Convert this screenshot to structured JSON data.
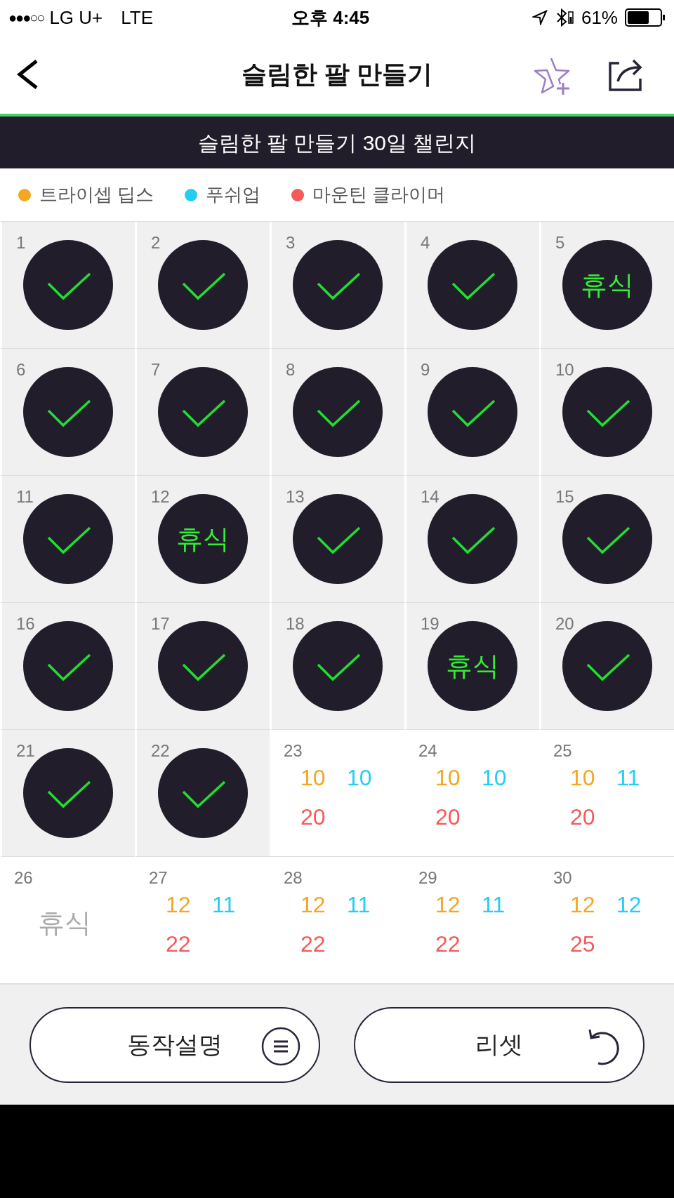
{
  "status_bar": {
    "signal": "●●●○○",
    "carrier": "LG U+",
    "network": "LTE",
    "time": "오후 4:45",
    "battery_percent": "61%"
  },
  "nav": {
    "title": "슬림한 팔 만들기"
  },
  "banner": "슬림한 팔 만들기 30일 챌린지",
  "legend": [
    {
      "label": "트라이셉 딥스",
      "color": "#f5a623"
    },
    {
      "label": "푸쉬업",
      "color": "#25cdf5"
    },
    {
      "label": "마운틴 클라이머",
      "color": "#f55a5a"
    }
  ],
  "days": [
    {
      "day": "1",
      "kind": "done"
    },
    {
      "day": "2",
      "kind": "done"
    },
    {
      "day": "3",
      "kind": "done"
    },
    {
      "day": "4",
      "kind": "done"
    },
    {
      "day": "5",
      "kind": "rest_done",
      "label": "휴식"
    },
    {
      "day": "6",
      "kind": "done"
    },
    {
      "day": "7",
      "kind": "done"
    },
    {
      "day": "8",
      "kind": "done"
    },
    {
      "day": "9",
      "kind": "done"
    },
    {
      "day": "10",
      "kind": "done"
    },
    {
      "day": "11",
      "kind": "done"
    },
    {
      "day": "12",
      "kind": "rest_done",
      "label": "휴식"
    },
    {
      "day": "13",
      "kind": "done"
    },
    {
      "day": "14",
      "kind": "done"
    },
    {
      "day": "15",
      "kind": "done"
    },
    {
      "day": "16",
      "kind": "done"
    },
    {
      "day": "17",
      "kind": "done"
    },
    {
      "day": "18",
      "kind": "done"
    },
    {
      "day": "19",
      "kind": "rest_done",
      "label": "휴식"
    },
    {
      "day": "20",
      "kind": "done"
    },
    {
      "day": "21",
      "kind": "done"
    },
    {
      "day": "22",
      "kind": "done"
    },
    {
      "day": "23",
      "kind": "plan",
      "reps": [
        "10",
        "10",
        "20"
      ]
    },
    {
      "day": "24",
      "kind": "plan",
      "reps": [
        "10",
        "10",
        "20"
      ]
    },
    {
      "day": "25",
      "kind": "plan",
      "reps": [
        "10",
        "11",
        "20"
      ]
    },
    {
      "day": "26",
      "kind": "rest",
      "label": "휴식"
    },
    {
      "day": "27",
      "kind": "plan",
      "reps": [
        "12",
        "11",
        "22"
      ]
    },
    {
      "day": "28",
      "kind": "plan",
      "reps": [
        "12",
        "11",
        "22"
      ]
    },
    {
      "day": "29",
      "kind": "plan",
      "reps": [
        "12",
        "11",
        "22"
      ]
    },
    {
      "day": "30",
      "kind": "plan",
      "reps": [
        "12",
        "12",
        "25"
      ]
    }
  ],
  "buttons": [
    {
      "label": "동작설명",
      "kind": "menu"
    },
    {
      "label": "리셋",
      "kind": "reset"
    }
  ]
}
